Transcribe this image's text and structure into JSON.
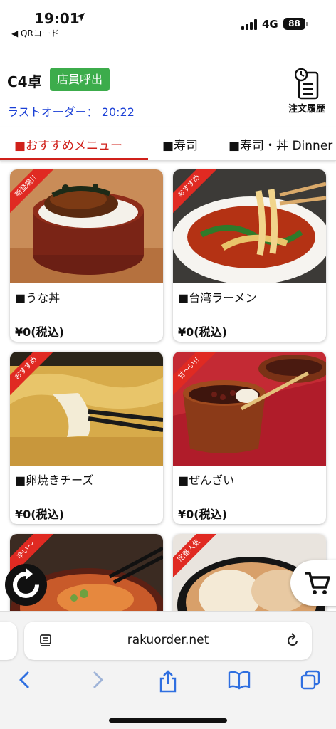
{
  "status_bar": {
    "time": "19:01",
    "back_app": "◀ QRコード",
    "network": "4G",
    "battery": "88"
  },
  "header": {
    "table_no": "C4卓",
    "call_staff": "店員呼出",
    "last_order": "ラストオーダー： 20:22",
    "history": "注文履歴"
  },
  "tabs": [
    {
      "label": "■おすすめメニュー",
      "active": true
    },
    {
      "label": "■寿司",
      "active": false
    },
    {
      "label": "■寿司・丼 Dinner",
      "active": false
    }
  ],
  "items": [
    {
      "name": "■うな丼",
      "price": "¥0(税込)",
      "badge": "新登場!!",
      "photo": "unadon"
    },
    {
      "name": "■台湾ラーメン",
      "price": "¥0(税込)",
      "badge": "おすすめ",
      "photo": "ramen"
    },
    {
      "name": "■卵焼きチーズ",
      "price": "¥0(税込)",
      "badge": "おすすめ",
      "photo": "tamago"
    },
    {
      "name": "■ぜんざい",
      "price": "¥0(税込)",
      "badge": "甘～い!!",
      "photo": "zenzai"
    },
    {
      "name": "",
      "price": "",
      "badge": "辛い～",
      "photo": "spicy"
    },
    {
      "name": "",
      "price": "",
      "badge": "定番人気",
      "photo": "mochi"
    }
  ],
  "browser": {
    "url": "rakuorder.net"
  },
  "colors": {
    "accent_red": "#d0201a",
    "call_green": "#3cac4b",
    "last_order_blue": "#1a3fd6",
    "ios_blue": "#2f6fe0"
  }
}
